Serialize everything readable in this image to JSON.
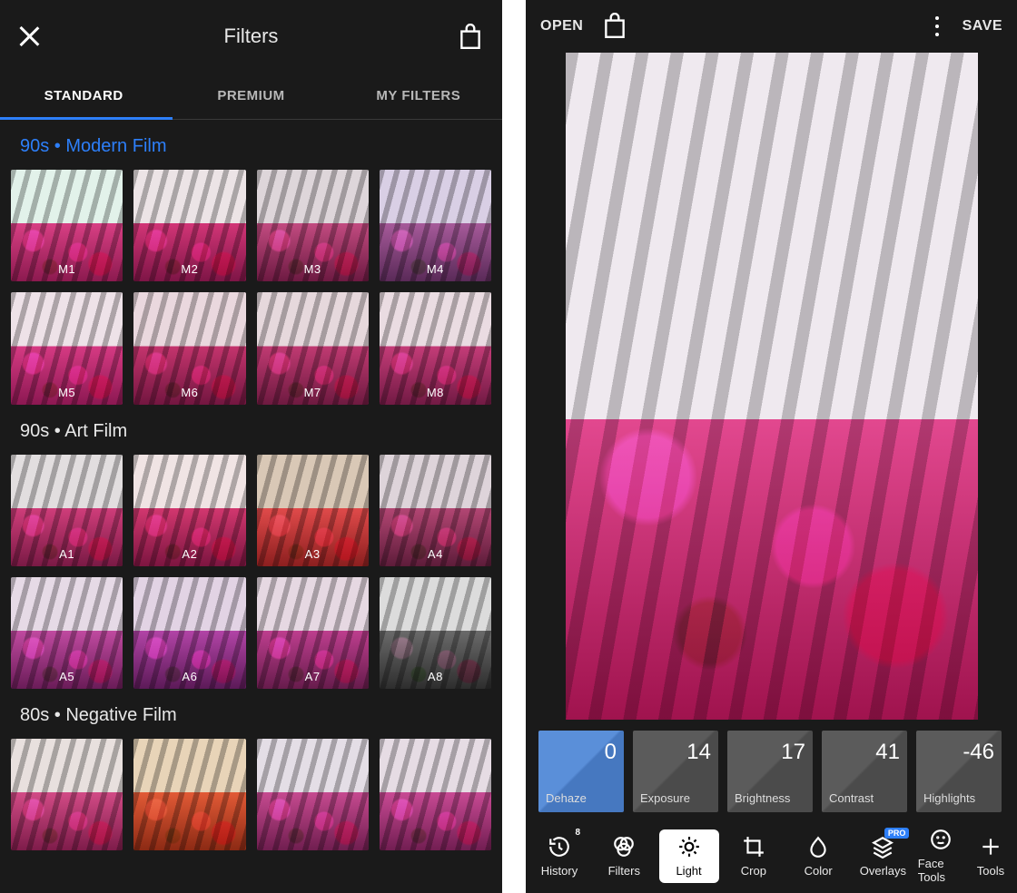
{
  "left": {
    "title": "Filters",
    "tabs": [
      "STANDARD",
      "PREMIUM",
      "MY FILTERS"
    ],
    "activeTab": 0,
    "sections": [
      {
        "title": "90s • Modern Film",
        "accent": true,
        "items": [
          {
            "label": "M1",
            "wall": "#e2f2ea",
            "flower": "#d83f84",
            "flower2": "#8c1a4f"
          },
          {
            "label": "M2",
            "wall": "#ece4e6",
            "flower": "#d23577",
            "flower2": "#7e1546"
          },
          {
            "label": "M3",
            "wall": "#ded6da",
            "flower": "#c24b80",
            "flower2": "#6d1a42"
          },
          {
            "label": "M4",
            "wall": "#d9cfe5",
            "flower": "#a65a9a",
            "flower2": "#5a2a58"
          },
          {
            "label": "M5",
            "wall": "#eee2e8",
            "flower": "#d63a83",
            "flower2": "#8c1852"
          },
          {
            "label": "M6",
            "wall": "#ead8de",
            "flower": "#c4346d",
            "flower2": "#731640"
          },
          {
            "label": "M7",
            "wall": "#e6d8dc",
            "flower": "#c03a72",
            "flower2": "#6e1a40"
          },
          {
            "label": "M8",
            "wall": "#eadce2",
            "flower": "#c43c78",
            "flower2": "#721a44"
          }
        ]
      },
      {
        "title": "90s • Art Film",
        "accent": false,
        "items": [
          {
            "label": "A1",
            "wall": "#e2dedf",
            "flower": "#cf3d7a",
            "flower2": "#7a1a45"
          },
          {
            "label": "A2",
            "wall": "#f0e4e4",
            "flower": "#d2376f",
            "flower2": "#7c1540"
          },
          {
            "label": "A3",
            "wall": "#d9c8b6",
            "flower": "#e04a4a",
            "flower2": "#8c1f1f"
          },
          {
            "label": "A4",
            "wall": "#ded4da",
            "flower": "#b24673",
            "flower2": "#5e1c3a"
          },
          {
            "label": "A5",
            "wall": "#e6dae6",
            "flower": "#c04aa0",
            "flower2": "#6a1c58"
          },
          {
            "label": "A6",
            "wall": "#e2d3e4",
            "flower": "#b244a6",
            "flower2": "#5c1a58"
          },
          {
            "label": "A7",
            "wall": "#e6d8e2",
            "flower": "#bd3e8e",
            "flower2": "#671c4c"
          },
          {
            "label": "A8",
            "wall": "#dcdcdc",
            "flower": "#6a6a6a",
            "flower2": "#2e2e2e"
          }
        ]
      },
      {
        "title": "80s • Negative Film",
        "accent": false,
        "items": [
          {
            "label": "",
            "wall": "#e8e0de",
            "flower": "#d24b86",
            "flower2": "#7e1c4a"
          },
          {
            "label": "",
            "wall": "#e8d4b8",
            "flower": "#e25a36",
            "flower2": "#8c2a14"
          },
          {
            "label": "",
            "wall": "#e4dee6",
            "flower": "#c64a90",
            "flower2": "#701e50"
          },
          {
            "label": "",
            "wall": "#e6dce4",
            "flower": "#c84a94",
            "flower2": "#721e52"
          }
        ]
      }
    ]
  },
  "right": {
    "open": "OPEN",
    "save": "SAVE",
    "sliders": [
      {
        "name": "Dehaze",
        "value": "0",
        "active": true
      },
      {
        "name": "Exposure",
        "value": "14"
      },
      {
        "name": "Brightness",
        "value": "17"
      },
      {
        "name": "Contrast",
        "value": "41"
      },
      {
        "name": "Highlights",
        "value": "-46"
      }
    ],
    "tools": [
      {
        "name": "History",
        "icon": "history",
        "count": "8"
      },
      {
        "name": "Filters",
        "icon": "filters"
      },
      {
        "name": "Light",
        "icon": "light",
        "active": true
      },
      {
        "name": "Crop",
        "icon": "crop"
      },
      {
        "name": "Color",
        "icon": "color"
      },
      {
        "name": "Overlays",
        "icon": "overlays",
        "badge": "PRO"
      },
      {
        "name": "Face Tools",
        "icon": "face",
        "edge": true
      },
      {
        "name": "Tools",
        "icon": "plus",
        "edge": true
      }
    ]
  }
}
